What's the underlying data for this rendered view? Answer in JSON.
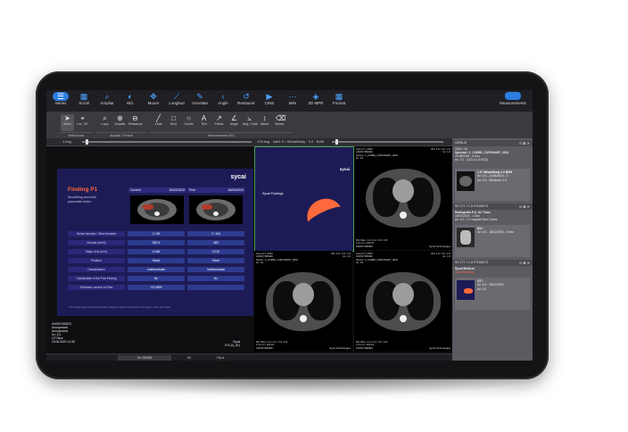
{
  "toolbar": {
    "items": [
      {
        "label": "Sèries",
        "icon": "series-icon"
      },
      {
        "label": "Scroll",
        "icon": "grid-icon"
      },
      {
        "label": "Ampliar",
        "icon": "zoom-icon"
      },
      {
        "label": "W/L",
        "icon": "contrast-icon"
      },
      {
        "label": "Moure",
        "icon": "move-icon"
      },
      {
        "label": "Longitud",
        "icon": "ruler-icon"
      },
      {
        "label": "Annotate",
        "icon": "annotate-icon"
      },
      {
        "label": "Angle",
        "icon": "angle-icon"
      },
      {
        "label": "Restaurar",
        "icon": "restore-icon"
      },
      {
        "label": "CINE",
        "icon": "play-icon"
      },
      {
        "label": "Més",
        "icon": "more-icon"
      },
      {
        "label": "2D MPR",
        "icon": "cube-icon"
      },
      {
        "label": "Format",
        "icon": "layout-icon"
      }
    ],
    "measurements": "Measurements"
  },
  "toolbar2": {
    "items": [
      {
        "label": "Selec",
        "icon": "cursor-icon"
      },
      {
        "label": "Loc. 3D",
        "icon": "crosshair-icon"
      },
      {
        "label": "Lupa",
        "icon": "magnifier-icon"
      },
      {
        "label": "Ampliar",
        "icon": "zoom-box-icon"
      },
      {
        "label": "Restaurar",
        "icon": "reset-zoom-icon"
      },
      {
        "label": "Línia",
        "icon": "line-icon"
      },
      {
        "label": "Rect",
        "icon": "rect-icon"
      },
      {
        "label": "Cercle",
        "icon": "circle-icon"
      },
      {
        "label": "Text",
        "icon": "text-icon"
      },
      {
        "label": "Fletxa",
        "icon": "arrow-icon"
      },
      {
        "label": "Angle",
        "icon": "angle2-icon"
      },
      {
        "label": "Ang. Cobb",
        "icon": "cobb-icon"
      },
      {
        "label": "Altura",
        "icon": "height-icon"
      },
      {
        "label": "Borrar",
        "icon": "eraser-icon"
      }
    ],
    "groups": [
      "Selecciona",
      "Ampliar / Reduir",
      "Mesuraments ROI"
    ]
  },
  "strip": {
    "left": "1 img",
    "right": "178 img · 1861 S / WholeBody · 2.0 · B20f"
  },
  "report": {
    "logo": "sycai",
    "title": "Finding P1",
    "subtitle": "Smoothing and solid pancreatic lesion",
    "col_current": "Current",
    "col_current_date": "20/04/2023",
    "col_prior": "Prior",
    "col_prior_date": "18/04/2023",
    "rows": [
      {
        "k": "Series Number / Slice Number",
        "a": "2 / 89",
        "b": "2 / 104"
      },
      {
        "k": "Volume (mm3)",
        "a": "587.6",
        "b": "483"
      },
      {
        "k": "Major Axis (mm)",
        "a": "10.86",
        "b": "10.20"
      },
      {
        "k": "Position",
        "a": "Head",
        "b": "Head"
      },
      {
        "k": "Classification",
        "a": "Indeterminate",
        "b": "Indeterminate"
      },
      {
        "k": "Calcification in the Pan Finding",
        "a": "No",
        "b": "No"
      },
      {
        "k": "Evolution current vs Prior",
        "a": "+21.65%",
        "b": "-"
      }
    ],
    "footnote": "* The Sycai report presents the data related to lesions detected in the region of the pancreas.",
    "meta_left": [
      "ANONYMIZED",
      "Anonymized",
      "Anonymized",
      "Im: 1/1",
      "OT Slice",
      "20:06:2023 14:38"
    ],
    "meta_right": [
      "Sycai",
      "SYCAI_001"
    ]
  },
  "slide": {
    "logo": "sycai",
    "title": "Sycai Findings"
  },
  "ct": {
    "tl": [
      "Anon.CT_0001",
      "ANONYMIZED",
      "Series: 1_COMBI_CORONARY_0001",
      "Im: 1/1",
      "Ax: 1.0"
    ],
    "tr": [
      "W:L 2.0 / 0.0 / 2.0",
      "Ax: 1.0"
    ],
    "bl": [
      "DS: Bas / 1.0 / 0.2 / 3.0 / 0.8",
      "1.5 mm / 100 kV",
      "ANONYMIZED"
    ],
    "br": [
      "Sycai Technologies"
    ]
  },
  "side": {
    "header1": "GRELB",
    "header1_sub": "2024 / 14",
    "study1_title": "Spectral / 1_COMBI_CORONARY_0001",
    "study1_lines": [
      "21/06/2024 - 5 foto",
      "Ax: 1/1 - (UCLA 1:5 MZZ)"
    ],
    "card1_title": "1.5 / WholeBody 2.0 B20f",
    "card1_lines": [
      "Ax: 1/1 - 21/06/2024 - 0",
      "Ax: 1/1 - Sessions: 1.5"
    ],
    "header2": "00 177 / 1.5 P/190072",
    "study2_title": "Radiografia P.A. de Tòrax",
    "study2_lines": [
      "18/07/2024 - 1 foto",
      "Ax: 1/1 - H. Hospital Sant Carles"
    ],
    "card2_title": "DX /",
    "card2_lines": [
      "Ax: 1/1 - 18/11/2019 - 0 foto"
    ],
    "header3": "00 177 / 1.5 P/190072",
    "study3_title": "Sycai Medical",
    "study3_sub": "Sycai Findings",
    "card3_title": "OT /",
    "card3_lines": [
      "Ax: 1/1 - 18/11/2019",
      "Ax: 1/1"
    ]
  },
  "bottombar": {
    "left": "Im: 35/455",
    "mid": "SC",
    "right": "TÀLA"
  }
}
